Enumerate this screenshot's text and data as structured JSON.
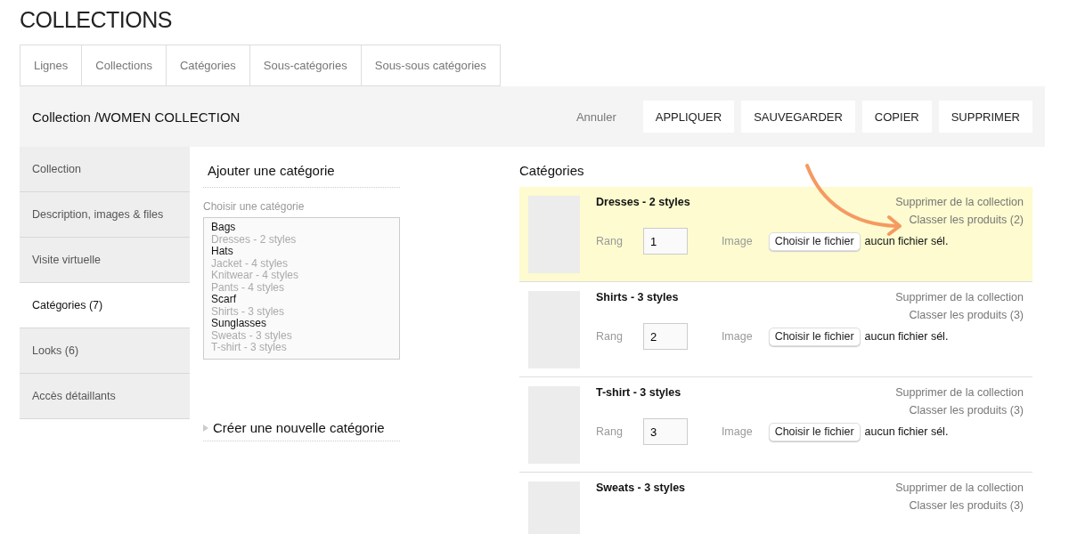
{
  "title": "COLLECTIONS",
  "tabs": [
    "Lignes",
    "Collections",
    "Catégories",
    "Sous-catégories",
    "Sous-sous catégories"
  ],
  "header": {
    "title": "Collection /WOMEN COLLECTION",
    "cancel": "Annuler",
    "buttons": [
      "APPLIQUER",
      "SAUVEGARDER",
      "COPIER",
      "SUPPRIMER"
    ]
  },
  "sidebar": {
    "items": [
      {
        "label": "Collection",
        "selected": false
      },
      {
        "label": "Description, images & files",
        "selected": false
      },
      {
        "label": "Visite virtuelle",
        "selected": false
      },
      {
        "label": "Catégories (7)",
        "selected": true
      },
      {
        "label": "Looks (6)",
        "selected": false
      },
      {
        "label": "Accès détaillants",
        "selected": false
      }
    ]
  },
  "add_category": {
    "heading": "Ajouter une catégorie",
    "label": "Choisir une catégorie",
    "options": [
      {
        "label": "Bags",
        "disabled": false
      },
      {
        "label": "Dresses - 2 styles",
        "disabled": true
      },
      {
        "label": "Hats",
        "disabled": false
      },
      {
        "label": "Jacket - 4 styles",
        "disabled": true
      },
      {
        "label": "Knitwear - 4 styles",
        "disabled": true
      },
      {
        "label": "Pants - 4 styles",
        "disabled": true
      },
      {
        "label": "Scarf",
        "disabled": false
      },
      {
        "label": "Shirts - 3 styles",
        "disabled": true
      },
      {
        "label": "Sunglasses",
        "disabled": false
      },
      {
        "label": "Sweats - 3 styles",
        "disabled": true
      },
      {
        "label": "T-shirt - 3 styles",
        "disabled": true
      }
    ],
    "create": "Créer une nouvelle catégorie"
  },
  "categories": {
    "heading": "Catégories",
    "rows": [
      {
        "name": "Dresses - 2 styles",
        "highlighted": true,
        "remove": "Supprimer de la collection",
        "sort": "Classer les produits (2)",
        "rank_label": "Rang",
        "rank": "1",
        "image_label": "Image",
        "file_button": "Choisir le fichier",
        "file_status": "aucun fichier sél."
      },
      {
        "name": "Shirts - 3 styles",
        "highlighted": false,
        "remove": "Supprimer de la collection",
        "sort": "Classer les produits (3)",
        "rank_label": "Rang",
        "rank": "2",
        "image_label": "Image",
        "file_button": "Choisir le fichier",
        "file_status": "aucun fichier sél."
      },
      {
        "name": "T-shirt - 3 styles",
        "highlighted": false,
        "remove": "Supprimer de la collection",
        "sort": "Classer les produits (3)",
        "rank_label": "Rang",
        "rank": "3",
        "image_label": "Image",
        "file_button": "Choisir le fichier",
        "file_status": "aucun fichier sél."
      },
      {
        "name": "Sweats - 3 styles",
        "highlighted": false,
        "remove": "Supprimer de la collection",
        "sort": "Classer les produits (3)"
      }
    ]
  }
}
